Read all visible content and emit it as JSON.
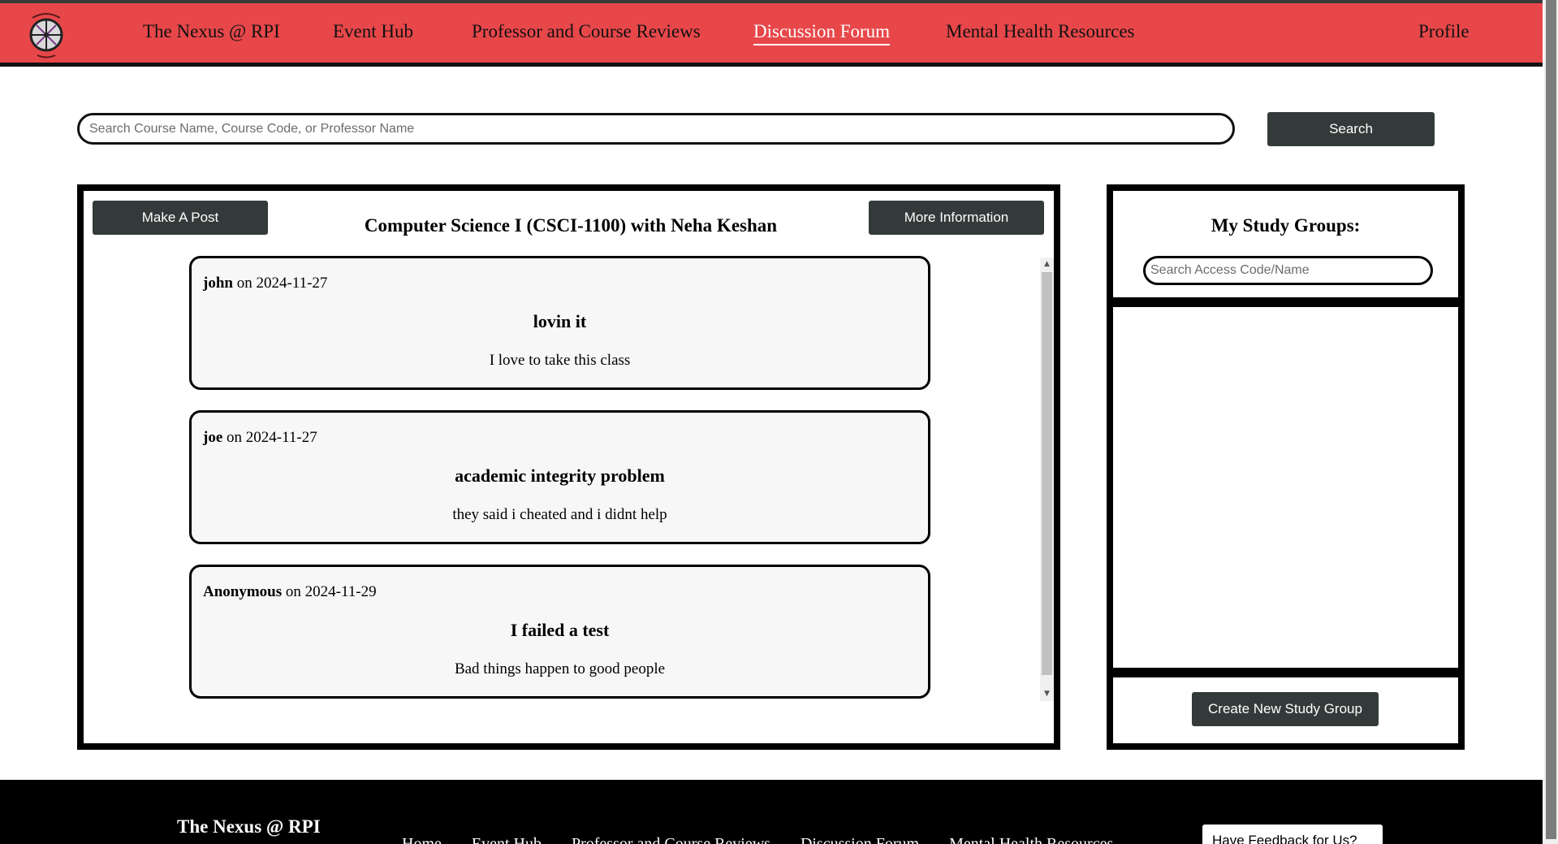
{
  "nav": {
    "items": [
      {
        "label": "The Nexus @ RPI"
      },
      {
        "label": "Event Hub"
      },
      {
        "label": "Professor and Course Reviews"
      },
      {
        "label": "Discussion Forum",
        "active": true
      },
      {
        "label": "Mental Health Resources"
      },
      {
        "label": "Profile"
      }
    ]
  },
  "search": {
    "placeholder": "Search Course Name, Course Code, or Professor Name",
    "button_label": "Search"
  },
  "forum": {
    "make_post_label": "Make A Post",
    "title": "Computer Science I (CSCI-1100) with Neha Keshan",
    "more_info_label": "More Information",
    "posts": [
      {
        "author": "john",
        "date_text": " on 2024-11-27",
        "title": "lovin it",
        "body": "I love to take this class"
      },
      {
        "author": "joe",
        "date_text": " on 2024-11-27",
        "title": "academic integrity problem",
        "body": "they said i cheated and i didnt help"
      },
      {
        "author": "Anonymous",
        "date_text": " on 2024-11-29",
        "title": "I failed a test",
        "body": "Bad things happen to good people"
      }
    ]
  },
  "study_groups": {
    "title": "My Study Groups:",
    "search_placeholder": "Search Access Code/Name",
    "create_label": "Create New Study Group"
  },
  "footer": {
    "title": "The Nexus @ RPI",
    "links": [
      "Home",
      "Event Hub",
      "Professor and Course Reviews",
      "Discussion Forum",
      "Mental Health Resources"
    ],
    "feedback_label": "Have Feedback for Us?"
  },
  "colors": {
    "nav_bg": "#e8474a",
    "button_bg": "#343a3a",
    "footer_bg": "#000000"
  },
  "icons": {
    "logo": "nexus-compass-logo",
    "scroll_up": "scroll-up-arrow-icon",
    "scroll_down": "scroll-down-arrow-icon"
  }
}
